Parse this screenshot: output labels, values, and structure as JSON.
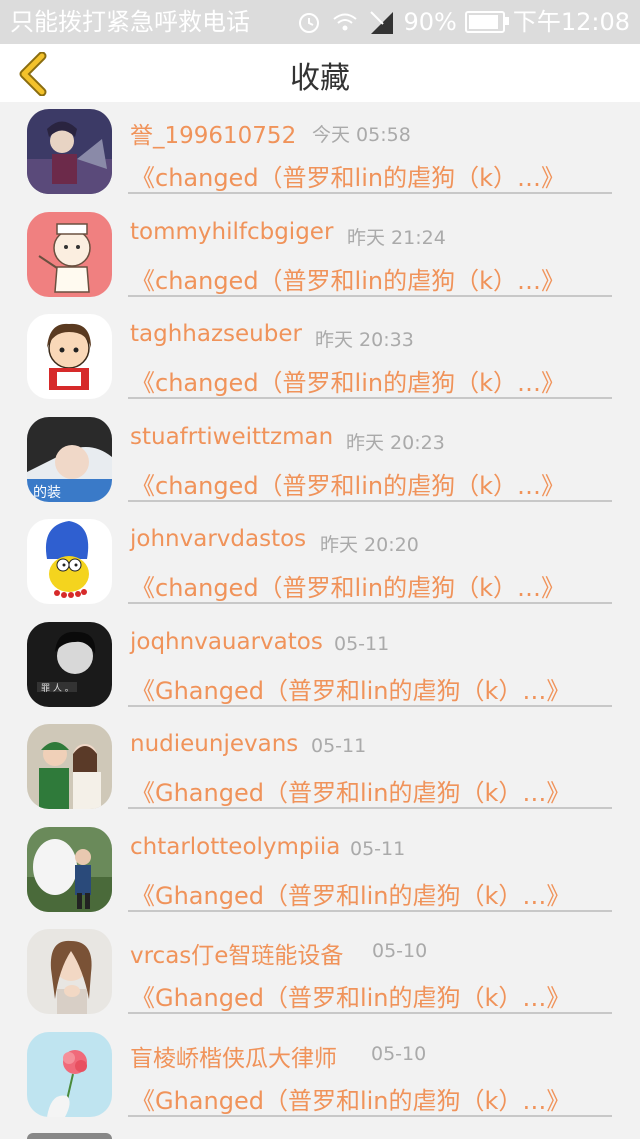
{
  "status_bar": {
    "carrier": "只能拨打紧急呼救电话",
    "battery": "90%",
    "time": "下午12:08"
  },
  "header": {
    "title": "收藏",
    "back_icon": "chevron-left-icon"
  },
  "favorites": [
    {
      "user": "誉_199610752",
      "time": "今天 05:58",
      "work": "《changed（普罗和lin的虐狗（k）…》"
    },
    {
      "user": "tommyhilfcbgiger",
      "time": "昨天 21:24",
      "work": "《changed（普罗和lin的虐狗（k）…》"
    },
    {
      "user": "taghhazseuber",
      "time": "昨天 20:33",
      "work": "《changed（普罗和lin的虐狗（k）…》"
    },
    {
      "user": "stuafrtiweittzman",
      "time": "昨天 20:23",
      "work": "《changed（普罗和lin的虐狗（k）…》"
    },
    {
      "user": "johnvarvdastos",
      "time": "昨天 20:20",
      "work": "《changed（普罗和lin的虐狗（k）…》"
    },
    {
      "user": "joqhnvauarvatos",
      "time": "05-11",
      "work": "《Ghanged（普罗和lin的虐狗（k）…》"
    },
    {
      "user": "nudieunjevans",
      "time": "05-11",
      "work": "《Ghanged（普罗和lin的虐狗（k）…》"
    },
    {
      "user": "chtarlotteolympiia",
      "time": "05-11",
      "work": "《Ghanged（普罗和lin的虐狗（k）…》"
    },
    {
      "user": "vrcas仃e智琏能设备",
      "time": "05-10",
      "work": "《Ghanged（普罗和lin的虐狗（k）…》"
    },
    {
      "user": "盲棱峤楷侠瓜大律师",
      "time": "05-10",
      "work": "《Ghanged（普罗和lin的虐狗（k）…》"
    }
  ],
  "colors": {
    "accent": "#f0935a",
    "back_icon": "#f3c22b",
    "timestamp": "#aaaaaa",
    "background": "#f2f2f2"
  }
}
